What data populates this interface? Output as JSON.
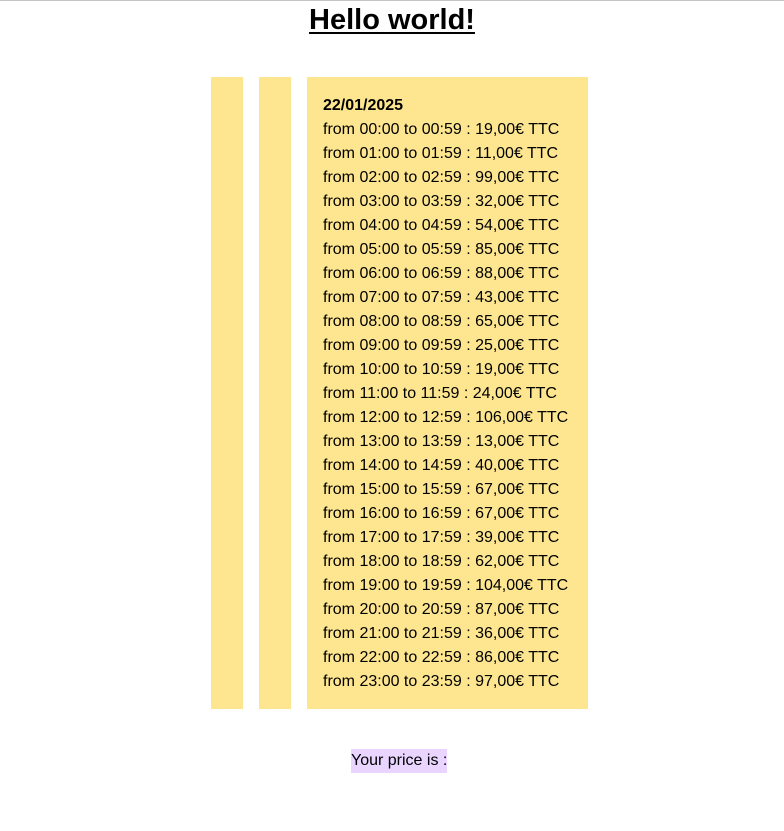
{
  "header": {
    "title": "Hello world!"
  },
  "schedule": {
    "date": "22/01/2025",
    "rows": [
      "from 00:00 to 00:59 : 19,00€ TTC",
      "from 01:00 to 01:59 : 11,00€ TTC",
      "from 02:00 to 02:59 : 99,00€ TTC",
      "from 03:00 to 03:59 : 32,00€ TTC",
      "from 04:00 to 04:59 : 54,00€ TTC",
      "from 05:00 to 05:59 : 85,00€ TTC",
      "from 06:00 to 06:59 : 88,00€ TTC",
      "from 07:00 to 07:59 : 43,00€ TTC",
      "from 08:00 to 08:59 : 65,00€ TTC",
      "from 09:00 to 09:59 : 25,00€ TTC",
      "from 10:00 to 10:59 : 19,00€ TTC",
      "from 11:00 to 11:59 : 24,00€ TTC",
      "from 12:00 to 12:59 : 106,00€ TTC",
      "from 13:00 to 13:59 : 13,00€ TTC",
      "from 14:00 to 14:59 : 40,00€ TTC",
      "from 15:00 to 15:59 : 67,00€ TTC",
      "from 16:00 to 16:59 : 67,00€ TTC",
      "from 17:00 to 17:59 : 39,00€ TTC",
      "from 18:00 to 18:59 : 62,00€ TTC",
      "from 19:00 to 19:59 : 104,00€ TTC",
      "from 20:00 to 20:59 : 87,00€ TTC",
      "from 21:00 to 21:59 : 36,00€ TTC",
      "from 22:00 to 22:59 : 86,00€ TTC",
      "from 23:00 to 23:59 : 97,00€ TTC"
    ]
  },
  "footer": {
    "price_label": "Your price is :"
  },
  "colors": {
    "column_bg": "#fde68f",
    "price_label_bg": "#e9d5ff"
  }
}
